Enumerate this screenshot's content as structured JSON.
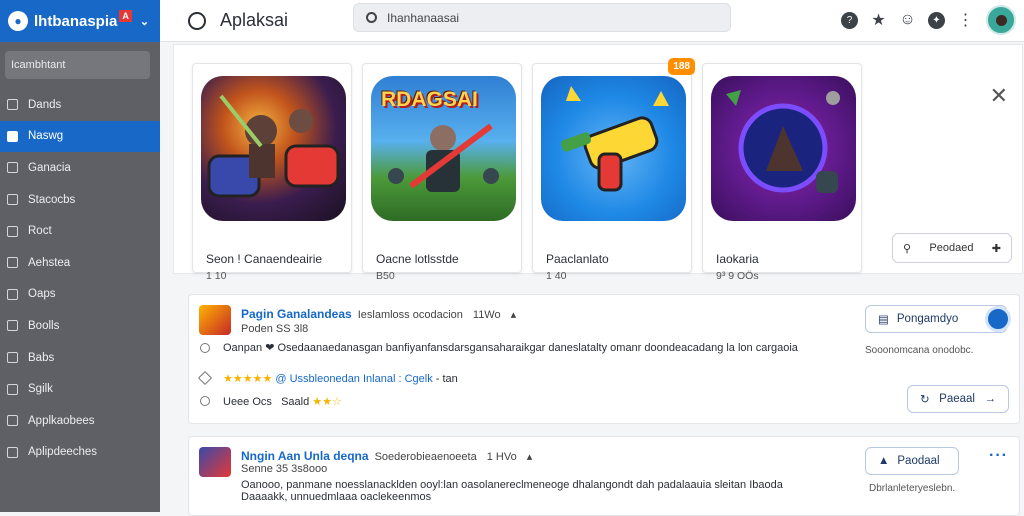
{
  "sidebar": {
    "brand": "lhtbanaspia",
    "brand_flag": "A",
    "search_label": "Icambhtant",
    "items": [
      {
        "label": "Dands",
        "active": false
      },
      {
        "label": "Naswg",
        "active": true
      },
      {
        "label": "Ganacia",
        "active": false
      },
      {
        "label": "Stacocbs",
        "active": false
      },
      {
        "label": "Roct",
        "active": false
      },
      {
        "label": "Aehstea",
        "active": false
      },
      {
        "label": "Oaps",
        "active": false
      },
      {
        "label": "Boolls",
        "active": false
      },
      {
        "label": "Babs",
        "active": false
      },
      {
        "label": "Sgilk",
        "active": false
      },
      {
        "label": "Applkaobees",
        "active": false
      },
      {
        "label": "Aplipdeeches",
        "active": false
      }
    ]
  },
  "topbar": {
    "title": "Aplaksai",
    "search_value": "Ihanhanaasai"
  },
  "featured": {
    "cards": [
      {
        "name": "Seon ! Canaendeairie",
        "meta": "1 10"
      },
      {
        "name": "Oacne lotlsstde",
        "meta": "B50",
        "art_title": "RDAGSAI"
      },
      {
        "name": "Paaclanlato",
        "meta": "1 40",
        "badge": "188"
      },
      {
        "name": "Iaokaria",
        "meta": "9³ 9 OÖs"
      }
    ],
    "action_label": "Peodaed"
  },
  "results": [
    {
      "title": "Pagin Ganalandeas",
      "subtitle": "Ieslamloss ocodacion",
      "count": "11Wo",
      "date": "Poden SS 3l8",
      "line1": "Oanpan ❤ Osedaanaedanasgan banfiyanfansdarsgansaharaikgar daneslatalty omanr doondeacadang la lon cargaoia",
      "line2_link": "@ Ussbleonedan Inlanal : Cgelk",
      "line2_tail": "- tan",
      "line3": "Ueee  Ocs",
      "line3_b": "Saald",
      "primary_btn": "Pongamdyo",
      "note": "Sooonomcana onodobc.",
      "secondary_btn": "Paeaal"
    },
    {
      "title": "Nngin Aan Unla deqna",
      "subtitle": "Soederobieaenoeeta",
      "count": "1 HVo",
      "date": "Senne 35 3s8ooo",
      "line1": "Oanooo, panmane noesslanacklden ooyl:lan oasolanereclmeneoge dhalangondt dah padalaauia sleitan Ibaoda",
      "line2": "Daaaakk, unnuedmlaaa oaclekeenmos",
      "primary_btn": "Paodaal",
      "note": "Dbrlanleteryeslebn."
    }
  ]
}
